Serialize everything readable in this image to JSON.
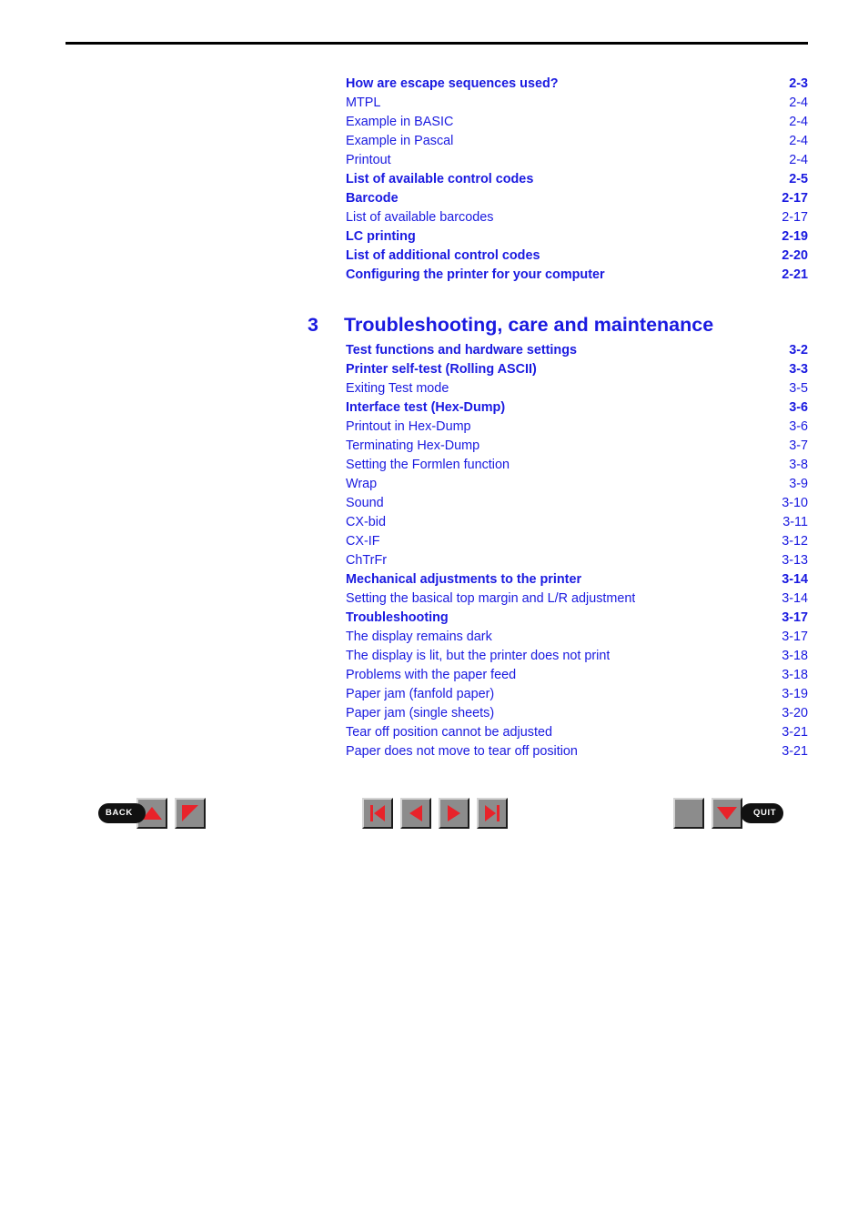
{
  "accent_color": "#1a1ae0",
  "header": {
    "rule": "horizontal-rule"
  },
  "toc_part1": [
    {
      "title": "How are escape sequences used?",
      "page": "2-3",
      "bold": true
    },
    {
      "title": "MTPL",
      "page": "2-4",
      "bold": false
    },
    {
      "title": "Example in BASIC",
      "page": "2-4",
      "bold": false
    },
    {
      "title": "Example in Pascal",
      "page": "2-4",
      "bold": false
    },
    {
      "title": "Printout",
      "page": "2-4",
      "bold": false
    },
    {
      "title": "List of available control codes",
      "page": "2-5",
      "bold": true
    },
    {
      "title": "Barcode",
      "page": "2-17",
      "bold": true
    },
    {
      "title": "List of available barcodes",
      "page": "2-17",
      "bold": false
    },
    {
      "title": "LC printing",
      "page": "2-19",
      "bold": true
    },
    {
      "title": "List of additional control codes",
      "page": "2-20",
      "bold": true
    },
    {
      "title": "Configuring the printer for your computer",
      "page": "2-21",
      "bold": true
    }
  ],
  "chapter": {
    "number": "3",
    "title": "Troubleshooting, care and maintenance"
  },
  "toc_part2": [
    {
      "title": "Test functions and hardware settings",
      "page": "3-2",
      "bold": true
    },
    {
      "title": "Printer self-test (Rolling ASCII)",
      "page": "3-3",
      "bold": true
    },
    {
      "title": "Exiting Test mode",
      "page": "3-5",
      "bold": false
    },
    {
      "title": "Interface test (Hex-Dump)",
      "page": "3-6",
      "bold": true
    },
    {
      "title": "Printout in Hex-Dump",
      "page": "3-6",
      "bold": false
    },
    {
      "title": "Terminating Hex-Dump",
      "page": "3-7",
      "bold": false
    },
    {
      "title": "Setting the Formlen function",
      "page": "3-8",
      "bold": false
    },
    {
      "title": "Wrap",
      "page": "3-9",
      "bold": false
    },
    {
      "title": "Sound",
      "page": "3-10",
      "bold": false
    },
    {
      "title": "CX-bid",
      "page": "3-11",
      "bold": false
    },
    {
      "title": "CX-IF",
      "page": "3-12",
      "bold": false
    },
    {
      "title": "ChTrFr",
      "page": "3-13",
      "bold": false
    },
    {
      "title": "Mechanical adjustments to the printer",
      "page": "3-14",
      "bold": true
    },
    {
      "title": "Setting the basical top margin and L/R adjustment",
      "page": "3-14",
      "bold": false
    },
    {
      "title": "Troubleshooting",
      "page": "3-17",
      "bold": true
    },
    {
      "title": "The display remains dark",
      "page": "3-17",
      "bold": false
    },
    {
      "title": "The display is lit, but the printer does not print",
      "page": "3-18",
      "bold": false
    },
    {
      "title": "Problems with the paper feed",
      "page": "3-18",
      "bold": false
    },
    {
      "title": "Paper jam (fanfold paper)",
      "page": "3-19",
      "bold": false
    },
    {
      "title": "Paper jam (single sheets)",
      "page": "3-20",
      "bold": false
    },
    {
      "title": "Tear off position cannot be adjusted",
      "page": "3-21",
      "bold": false
    },
    {
      "title": "Paper does not move to tear off position",
      "page": "3-21",
      "bold": false
    }
  ],
  "nav": {
    "back_label": "BACK",
    "quit_label": "QUIT",
    "button_color": "#8c8c8c",
    "glyph_color": "#e8232a",
    "left": {
      "back": "back-label",
      "up": "up-triangle-icon",
      "corner": "page-corner-icon"
    },
    "mid": {
      "first": "first-page-icon",
      "prev": "previous-page-icon",
      "next": "next-page-icon",
      "last": "last-page-icon"
    },
    "right": {
      "blank": "blank-button",
      "down": "down-triangle-icon",
      "quit": "quit-label"
    }
  }
}
